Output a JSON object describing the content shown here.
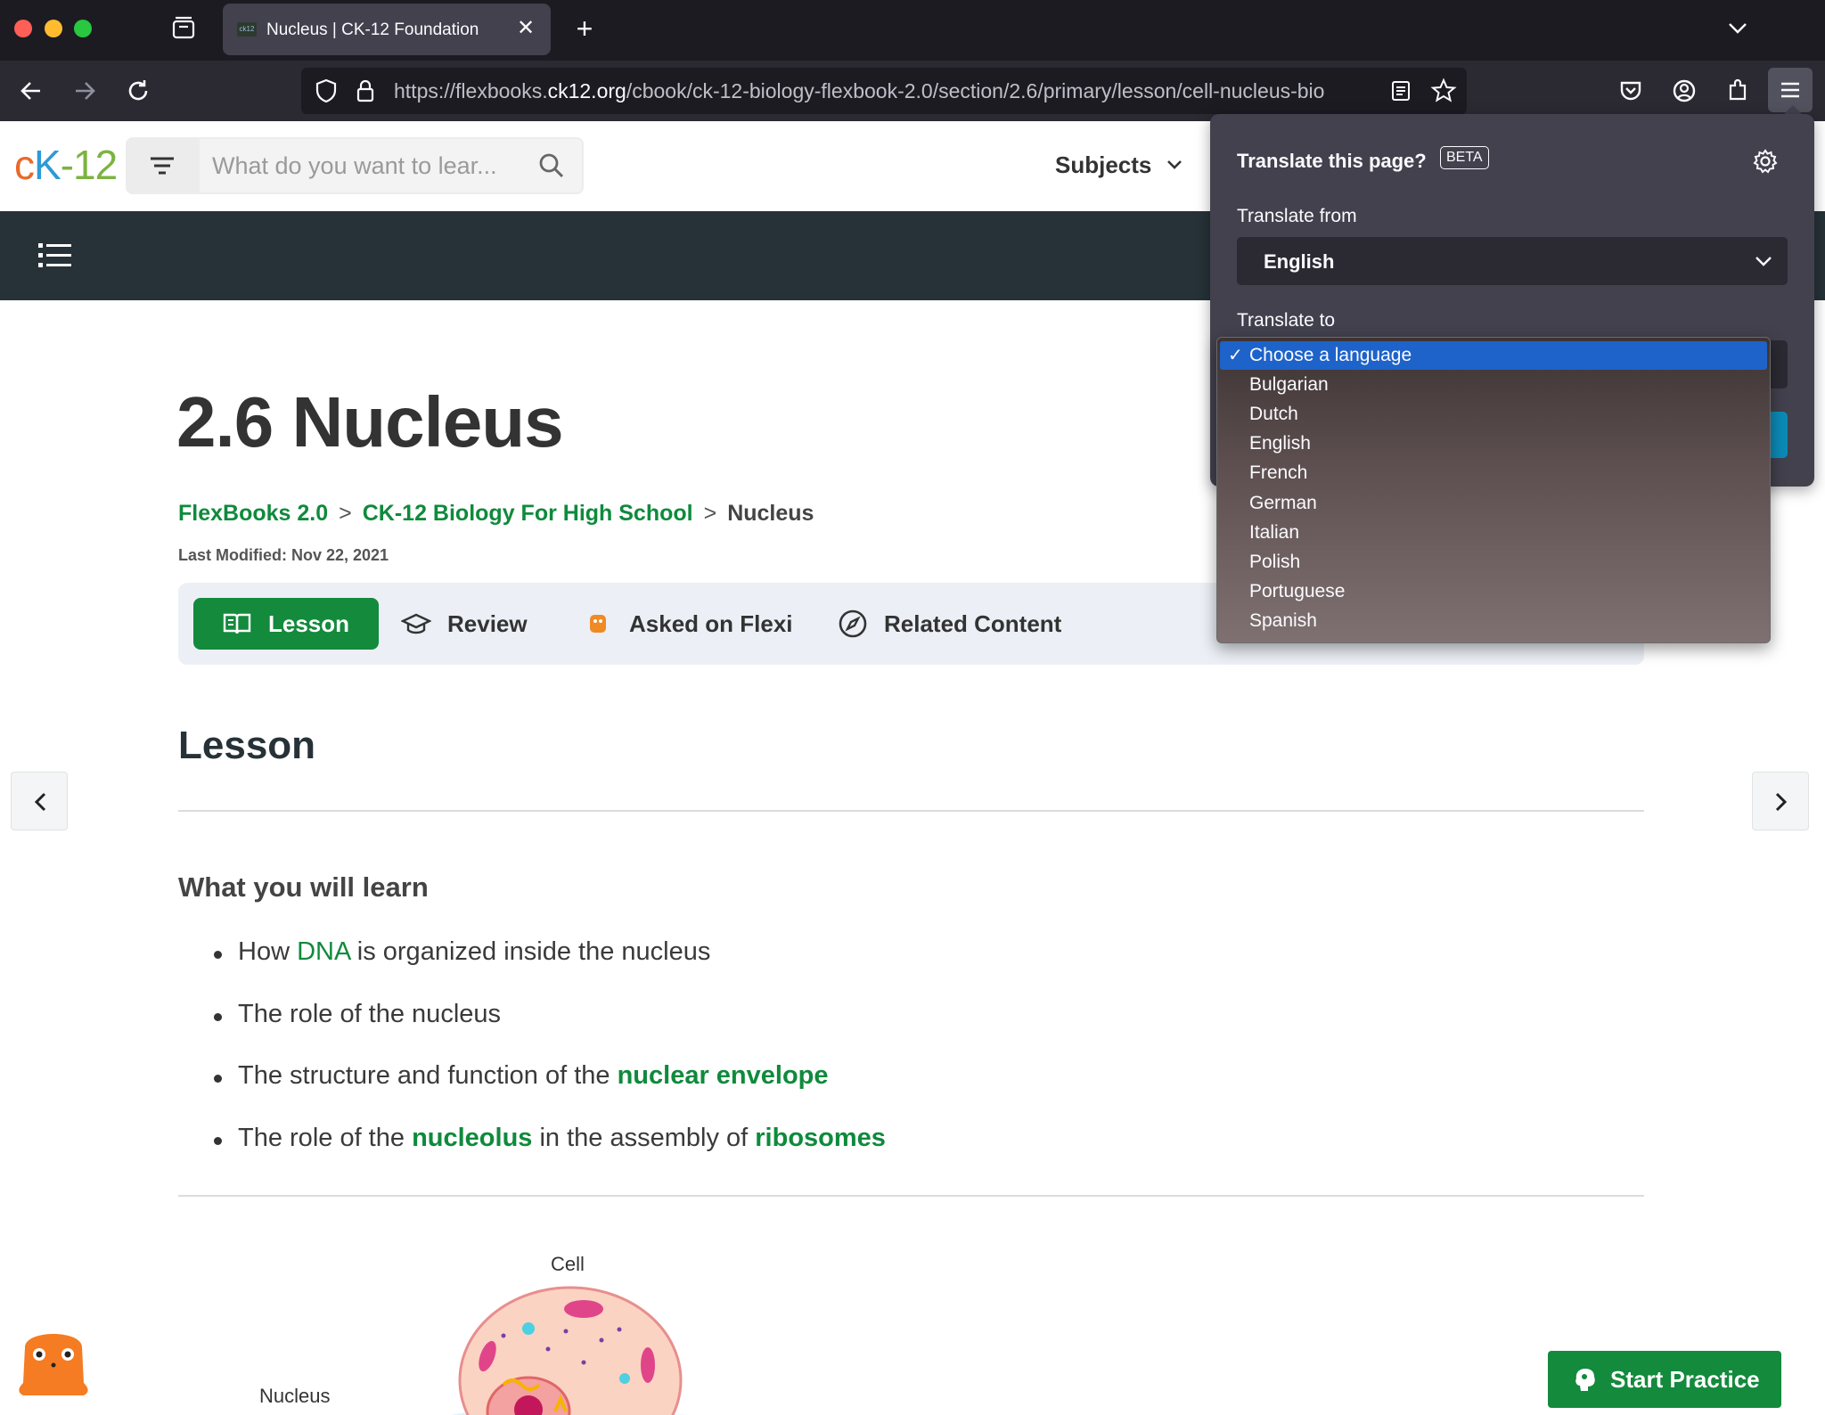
{
  "browser": {
    "tab_title": "Nucleus | CK-12 Foundation",
    "url_prefix": "https://flexbooks.",
    "url_domain": "ck12.org",
    "url_path": "/cbook/ck-12-biology-flexbook-2.0/section/2.6/primary/lesson/cell-nucleus-bio"
  },
  "header": {
    "logo": {
      "c": "c",
      "k": "K",
      "dash12": "-12"
    },
    "search_placeholder": "What do you want to lear...",
    "subjects_label": "Subjects"
  },
  "page": {
    "title": "2.6 Nucleus",
    "breadcrumb": [
      "FlexBooks 2.0",
      "CK-12 Biology For High School",
      "Nucleus"
    ],
    "breadcrumb_sep": ">",
    "last_modified": "Last Modified: Nov 22, 2021",
    "tabs": [
      "Lesson",
      "Review",
      "Asked on Flexi",
      "Related Content"
    ],
    "lesson_heading": "Lesson",
    "learn_heading": "What you will learn",
    "bullets": {
      "b1": {
        "pre": "How ",
        "link": "DNA",
        "post": " is organized inside the nucleus"
      },
      "b2": {
        "text": "The role of the nucleus"
      },
      "b3": {
        "pre": "The structure and function of the ",
        "link": "nuclear envelope"
      },
      "b4": {
        "pre": "The role of the ",
        "link1": "nucleolus",
        "mid": " in the assembly of ",
        "link2": "ribosomes"
      }
    },
    "figure": {
      "cell_label": "Cell",
      "nucleus_label": "Nucleus"
    },
    "start_practice": "Start Practice"
  },
  "translate_panel": {
    "title": "Translate this page?",
    "beta": "BETA",
    "from_label": "Translate from",
    "from_value": "English",
    "to_label": "Translate to",
    "options": [
      "Choose a language",
      "Bulgarian",
      "Dutch",
      "English",
      "French",
      "German",
      "Italian",
      "Polish",
      "Portuguese",
      "Spanish"
    ],
    "selected_index": 0
  },
  "colors": {
    "brand_green": "#138a3c",
    "dark_bar": "#263238",
    "select_highlight": "#1e63c9"
  }
}
